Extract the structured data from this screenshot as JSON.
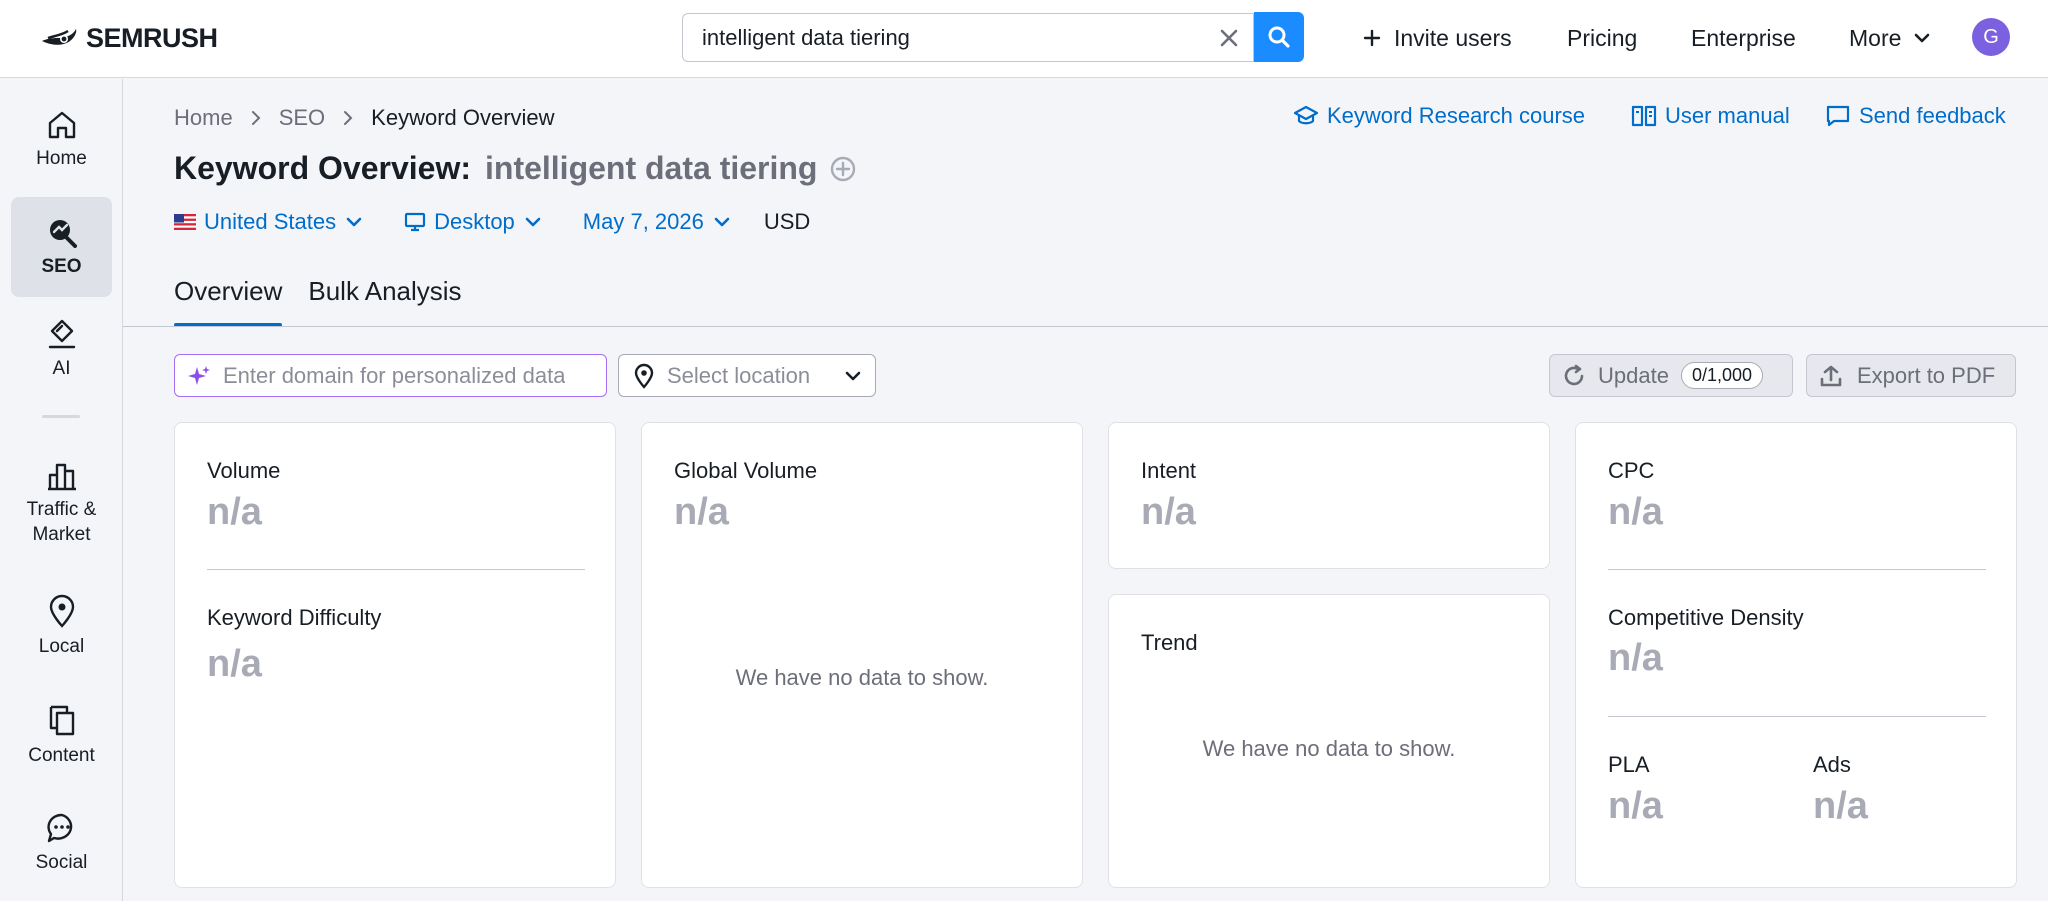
{
  "header": {
    "logo_text": "SEMRUSH",
    "search_value": "intelligent data tiering",
    "nav": {
      "invite_users": "Invite users",
      "pricing": "Pricing",
      "enterprise": "Enterprise",
      "more": "More"
    },
    "avatar_letter": "G",
    "accent_color": "#1a8cff"
  },
  "sidebar": {
    "items": [
      {
        "label": "Home",
        "icon": "home-icon"
      },
      {
        "label": "SEO",
        "icon": "seo-icon",
        "active": true
      },
      {
        "label": "AI",
        "icon": "ai-icon"
      },
      {
        "label": "Traffic & Market",
        "icon": "bar-chart-icon"
      },
      {
        "label": "Local",
        "icon": "map-pin-icon"
      },
      {
        "label": "Content",
        "icon": "content-icon"
      },
      {
        "label": "Social",
        "icon": "chat-bubble-icon"
      }
    ]
  },
  "breadcrumb": [
    "Home",
    "SEO",
    "Keyword Overview"
  ],
  "header_links": {
    "course": "Keyword Research course",
    "manual": "User manual",
    "feedback": "Send feedback"
  },
  "page": {
    "title": "Keyword Overview:",
    "keyword": "intelligent data tiering"
  },
  "filters": {
    "country": "United States",
    "device": "Desktop",
    "date": "May 7, 2026",
    "currency": "USD"
  },
  "tabs": [
    "Overview",
    "Bulk Analysis"
  ],
  "toolbar": {
    "domain_placeholder": "Enter domain for personalized data",
    "location_placeholder": "Select location",
    "update_label": "Update",
    "update_count": "0/1,000",
    "export_label": "Export to PDF"
  },
  "cards": {
    "volume": {
      "label": "Volume",
      "value": "n/a"
    },
    "keyword_difficulty": {
      "label": "Keyword Difficulty",
      "value": "n/a"
    },
    "global_volume": {
      "label": "Global Volume",
      "value": "n/a",
      "empty": "We have no data to show."
    },
    "intent": {
      "label": "Intent",
      "value": "n/a"
    },
    "trend": {
      "label": "Trend",
      "empty": "We have no data to show."
    },
    "cpc": {
      "label": "CPC",
      "value": "n/a"
    },
    "competitive_density": {
      "label": "Competitive Density",
      "value": "n/a"
    },
    "pla": {
      "label": "PLA",
      "value": "n/a"
    },
    "ads": {
      "label": "Ads",
      "value": "n/a"
    }
  }
}
